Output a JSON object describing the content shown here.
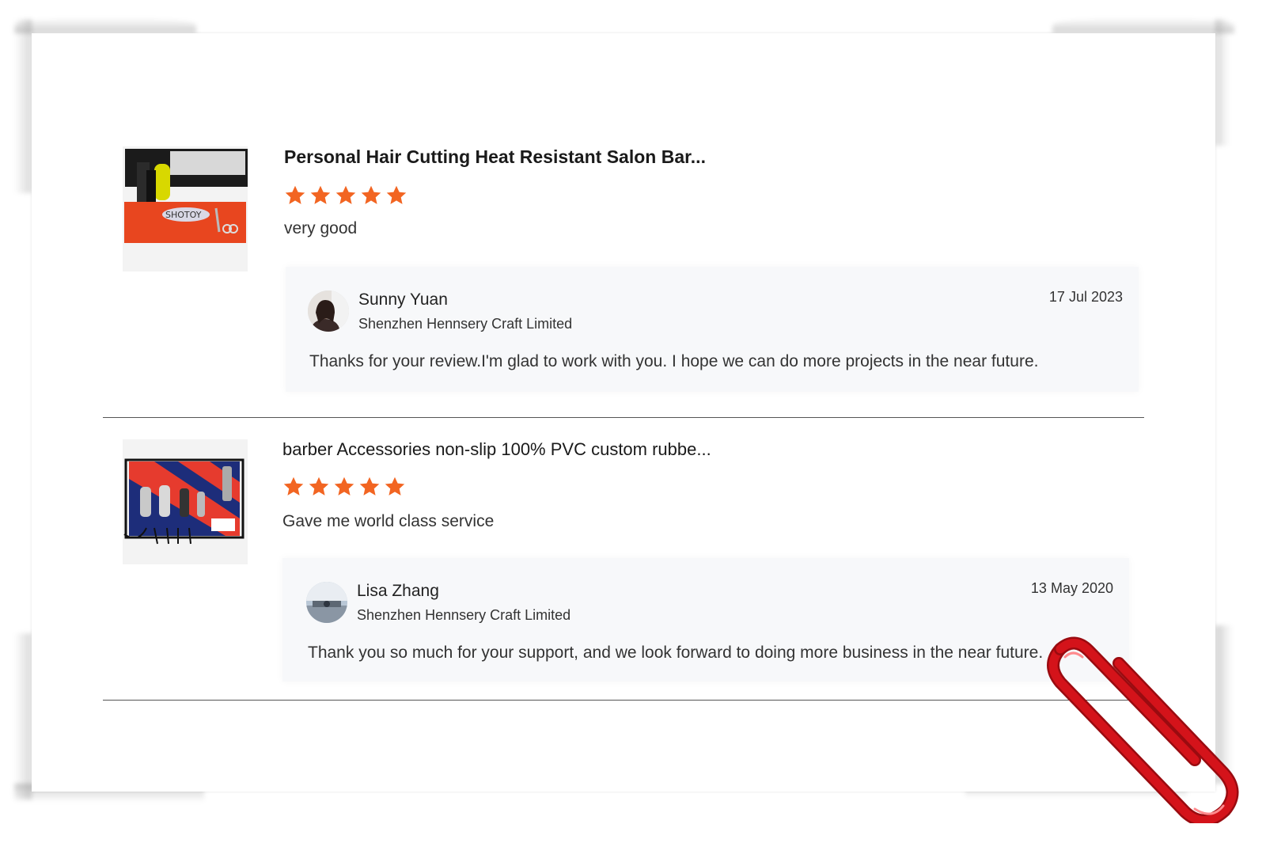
{
  "colors": {
    "star": "#f26522",
    "divider": "#555555",
    "reply_background": "#f7f8fa",
    "paperclip": "#d4131a"
  },
  "reviews": [
    {
      "product_title": "Personal Hair Cutting Heat Resistant Salon Bar...",
      "rating": 5,
      "comment": "very good",
      "thumbnail_icon": "product-thumbnail-orange-mat",
      "reply": {
        "name": "Sunny Yuan",
        "company": "Shenzhen Hennsery Craft Limited",
        "date": "17 Jul 2023",
        "text": "Thanks for your review.I'm glad to work with you. I hope we can do more projects in the near future."
      }
    },
    {
      "product_title": "barber Accessories non-slip 100% PVC custom rubbe...",
      "rating": 5,
      "comment": "Gave me world class service",
      "thumbnail_icon": "product-thumbnail-striped-mat",
      "reply": {
        "name": "Lisa Zhang",
        "company": "Shenzhen Hennsery Craft Limited",
        "date": "13 May 2020",
        "text": "Thank you so much for your support, and we look forward to doing more business in the near future."
      }
    }
  ]
}
